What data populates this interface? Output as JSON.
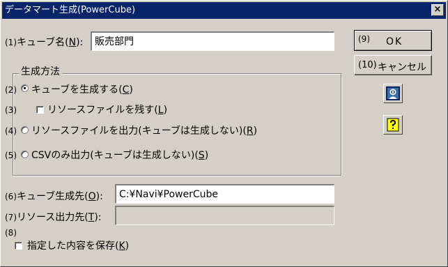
{
  "window": {
    "title": "データマート生成(PowerCube)",
    "close_label": "×"
  },
  "form": {
    "cube_name": {
      "number": "(1)",
      "label_prefix": "キューブ名(",
      "accel": "N",
      "label_suffix": "):",
      "value": "販売部門"
    },
    "method_group": {
      "title": "生成方法",
      "options": [
        {
          "number": "(2)",
          "prefix": "キューブを生成する(",
          "accel": "C",
          "suffix": ")",
          "selected": true
        },
        {
          "number": "(3)",
          "prefix": "リソースファイルを残す(",
          "accel": "L",
          "suffix": ")",
          "checkbox": true,
          "checked": false
        },
        {
          "number": "(4)",
          "prefix": "リソースファイルを出力(キューブは生成しない)(",
          "accel": "R",
          "suffix": ")",
          "selected": false
        },
        {
          "number": "(5)",
          "prefix": "CSVのみ出力(キューブは生成しない)(",
          "accel": "S",
          "suffix": ")",
          "selected": false
        }
      ]
    },
    "cube_dest": {
      "number": "(6)",
      "label_prefix": "キューブ生成先(",
      "accel": "O",
      "label_suffix": "):",
      "value": "C:¥Navi¥PowerCube"
    },
    "resource_dest": {
      "number": "(7)",
      "label_prefix": "リソース出力先(",
      "accel": "T",
      "label_suffix": "):",
      "value": ""
    },
    "save_settings": {
      "number": "(8)",
      "prefix": "指定した内容を保存(",
      "accel": "K",
      "suffix": ")",
      "checked": false
    }
  },
  "buttons": {
    "ok": {
      "number": "(9)",
      "label": "OK"
    },
    "cancel": {
      "number": "(10)",
      "label": "キャンセル"
    }
  },
  "icons": {
    "info": "info-person-icon",
    "help": "question-mark-help-icon"
  },
  "colors": {
    "titlebar": "#0a246a",
    "face": "#d4d0c8",
    "help_yellow": "#ffff00"
  }
}
